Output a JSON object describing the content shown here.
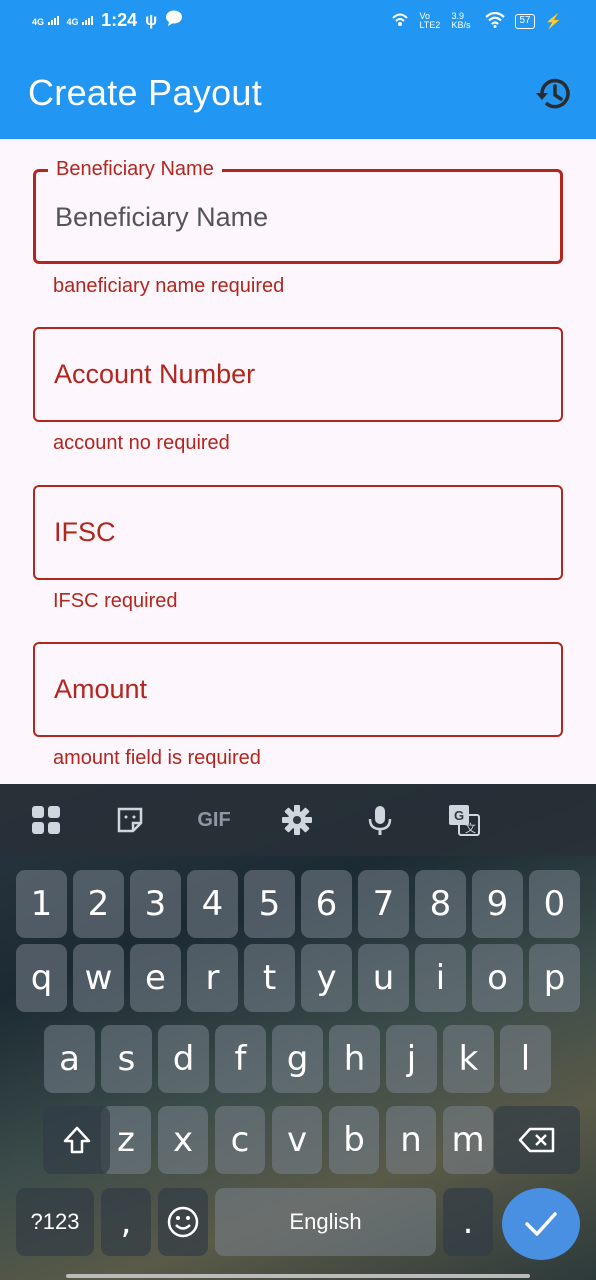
{
  "status": {
    "signal1": "4G",
    "signal2": "4G",
    "time": "1:24",
    "volte": "Vo LTE2",
    "speed": "3.9 KB/s",
    "battery": "57"
  },
  "appbar": {
    "title": "Create Payout",
    "history_icon": "history-icon"
  },
  "form": {
    "beneficiary": {
      "label": "Beneficiary Name",
      "value": "Beneficiary Name",
      "error": "baneficiary name required"
    },
    "account": {
      "placeholder": "Account Number",
      "error": "account no required"
    },
    "ifsc": {
      "placeholder": "IFSC",
      "error": "IFSC required"
    },
    "amount": {
      "placeholder": "Amount",
      "error": "amount field is required"
    }
  },
  "keyboard": {
    "toolbar": [
      "apps-icon",
      "sticker-icon",
      "GIF",
      "gear-icon",
      "mic-icon",
      "translate-icon"
    ],
    "row_numbers": [
      "1",
      "2",
      "3",
      "4",
      "5",
      "6",
      "7",
      "8",
      "9",
      "0"
    ],
    "row1": [
      "q",
      "w",
      "e",
      "r",
      "t",
      "y",
      "u",
      "i",
      "o",
      "p"
    ],
    "row2": [
      "a",
      "s",
      "d",
      "f",
      "g",
      "h",
      "j",
      "k",
      "l"
    ],
    "row3": [
      "z",
      "x",
      "c",
      "v",
      "b",
      "n",
      "m"
    ],
    "symbols_label": "?123",
    "comma": ",",
    "space_label": "English",
    "period": "."
  },
  "colors": {
    "primary": "#2196f3",
    "error": "#b3261e",
    "background": "#fdf7fd",
    "enter": "#4a90e2"
  }
}
